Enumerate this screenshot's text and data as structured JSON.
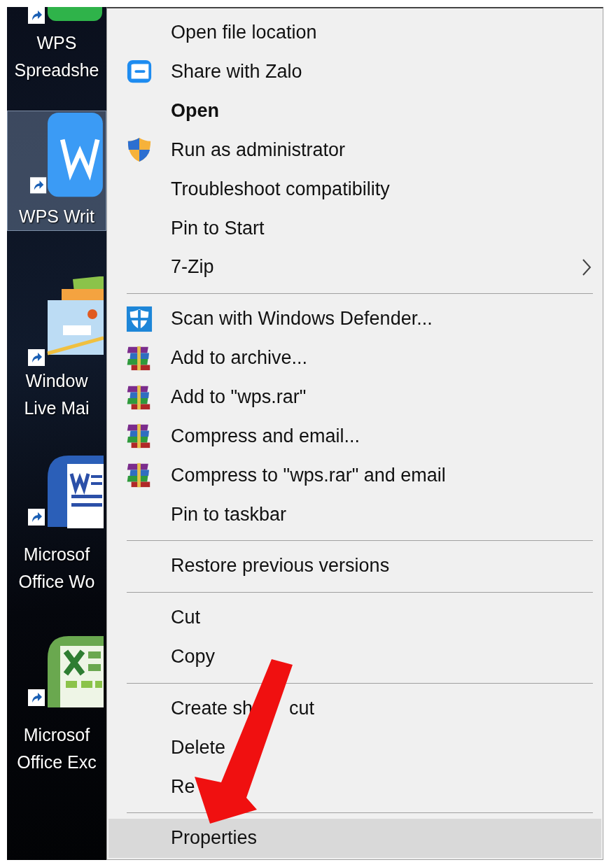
{
  "desktop": {
    "icons": [
      {
        "kind": "spreadsheet",
        "label": "WPS\nSpreadshe",
        "selected": false
      },
      {
        "kind": "writer",
        "label": "WPS Writ",
        "selected": true
      },
      {
        "kind": "mail",
        "label": "Window\nLive Mai",
        "selected": false
      },
      {
        "kind": "word",
        "label": "Microsof\nOffice Wo",
        "selected": false
      },
      {
        "kind": "excel",
        "label": "Microsof\nOffice Exc",
        "selected": false
      }
    ]
  },
  "context_menu": {
    "sections": [
      [
        {
          "label": "Open file location",
          "kind": "plain",
          "selected": false
        },
        {
          "label": "Share with Zalo",
          "kind": "zalo",
          "selected": false
        },
        {
          "label": "Open",
          "kind": "default",
          "selected": false
        },
        {
          "label": "Run as administrator",
          "kind": "shield",
          "selected": false
        },
        {
          "label": "Troubleshoot compatibility",
          "kind": "plain",
          "selected": false
        },
        {
          "label": "Pin to Start",
          "kind": "plain",
          "selected": false
        },
        {
          "label": "7-Zip",
          "kind": "submenu",
          "selected": false
        }
      ],
      [
        {
          "label": "Scan with Windows Defender...",
          "kind": "defender",
          "selected": false
        },
        {
          "label": "Add to archive...",
          "kind": "archive",
          "selected": false
        },
        {
          "label": "Add to \"wps.rar\"",
          "kind": "archive",
          "selected": false
        },
        {
          "label": "Compress and email...",
          "kind": "archive",
          "selected": false
        },
        {
          "label": "Compress to \"wps.rar\" and email",
          "kind": "archive",
          "selected": false
        },
        {
          "label": "Pin to taskbar",
          "kind": "plain",
          "selected": false
        }
      ],
      [
        {
          "label": "Restore previous versions",
          "kind": "plain",
          "selected": false
        }
      ],
      [
        {
          "label": "Cut",
          "kind": "plain",
          "selected": false
        },
        {
          "label": "Copy",
          "kind": "plain",
          "selected": false
        }
      ],
      [
        {
          "label": "Create sh",
          "label_tail": "cut",
          "kind": "plain",
          "selected": false
        },
        {
          "label": "Delete",
          "kind": "plain",
          "selected": false
        },
        {
          "label": "Re",
          "kind": "plain",
          "selected": false
        }
      ],
      [
        {
          "label": "Properties",
          "kind": "plain",
          "selected": true
        }
      ]
    ]
  }
}
